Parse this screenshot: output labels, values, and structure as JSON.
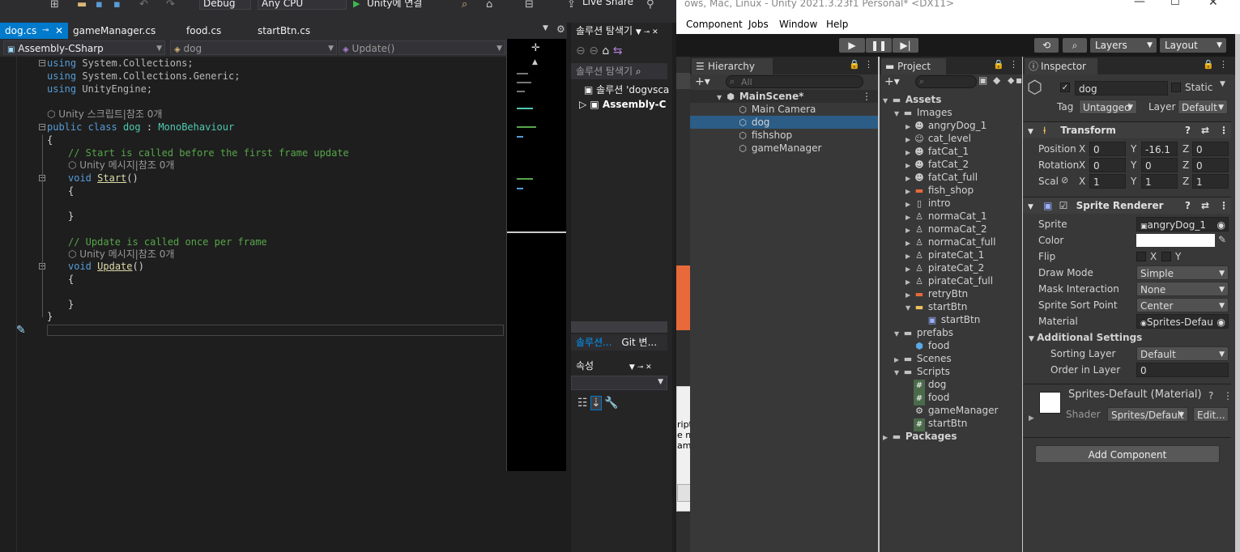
{
  "vs": {
    "toolbar": {
      "config": "Debug",
      "platform": "Any CPU",
      "run_label": "Unity에 연결",
      "live_share": "Live Share"
    },
    "tabs": [
      {
        "label": "dog.cs"
      },
      {
        "label": "gameManager.cs"
      },
      {
        "label": "food.cs"
      },
      {
        "label": "startBtn.cs"
      }
    ],
    "nav": {
      "project": "Assembly-CSharp",
      "class": "dog",
      "member": "Update()"
    },
    "code": {
      "using1_kw": "using",
      "using1": " System.Collections;",
      "using2_kw": "using",
      "using2": " System.Collections.Generic;",
      "using3_kw": "using",
      "using3": " UnityEngine;",
      "hint_class": "Unity 스크립트|참조 0개",
      "class_kw": "public class",
      "class_name": "dog",
      "class_sep": " : ",
      "class_base": "MonoBehaviour",
      "brace_open": "{",
      "comment_start": "// Start is called before the first frame update",
      "hint_start": "Unity 메시지|참조 0개",
      "start_kw": "void",
      "start_name": "Start",
      "start_paren": "()",
      "comment_update": "// Update is called once per frame",
      "hint_update": "Unity 메시지|참조 0개",
      "update_kw": "void",
      "update_name": "Update",
      "update_paren": "()",
      "brace_close": "}"
    },
    "solution": {
      "title": "솔루션 탐색기",
      "search": "솔루션 탐색기",
      "item1": "솔루션 'dogvsca",
      "item2": "Assembly-C",
      "tab1": "솔루션...",
      "tab2": "Git 변...",
      "props_title": "속성"
    }
  },
  "unity": {
    "title": "ows, Mac, Linux - Unity 2021.3.23f1 Personal* <DX11>",
    "menu": [
      "Component",
      "Jobs",
      "Window",
      "Help"
    ],
    "toolbar": {
      "layers": "Layers",
      "layout": "Layout"
    },
    "dialog_text": [
      "ript",
      "e no",
      "ame"
    ],
    "hierarchy": {
      "tab": "Hierarchy",
      "search_placeholder": "All",
      "scene": "MainScene*",
      "items": [
        "Main Camera",
        "dog",
        "fishshop",
        "gameManager"
      ]
    },
    "project": {
      "tab": "Project",
      "assets": "Assets",
      "images": "Images",
      "image_items": [
        "angryDog_1",
        "cat_level",
        "fatCat_1",
        "fatCat_2",
        "fatCat_full",
        "fish_shop",
        "intro",
        "normaCat_1",
        "normaCat_2",
        "normaCat_full",
        "pirateCat_1",
        "pirateCat_2",
        "pirateCat_full",
        "retryBtn",
        "startBtn"
      ],
      "startbtn_child": "startBtn",
      "prefabs": "prefabs",
      "prefab_items": [
        "food"
      ],
      "scenes": "Scenes",
      "scripts": "Scripts",
      "script_items": [
        "dog",
        "food",
        "gameManager",
        "startBtn"
      ],
      "packages": "Packages"
    },
    "inspector": {
      "tab": "Inspector",
      "name": "dog",
      "static_label": "Static",
      "tag_label": "Tag",
      "tag_value": "Untagged",
      "layer_label": "Layer",
      "layer_value": "Default",
      "transform": {
        "title": "Transform",
        "position_label": "Position",
        "position": {
          "x": "0",
          "y": "-16.1",
          "z": "0"
        },
        "rotation_label": "Rotation",
        "rotation": {
          "x": "0",
          "y": "0",
          "z": "0"
        },
        "scale_label": "Scal",
        "scale": {
          "x": "1",
          "y": "1",
          "z": "1"
        },
        "x": "X",
        "y": "Y",
        "z": "Z"
      },
      "sprite_renderer": {
        "title": "Sprite Renderer",
        "sprite_label": "Sprite",
        "sprite_value": "angryDog_1",
        "color_label": "Color",
        "color_value": "#ffffff",
        "flip_label": "Flip",
        "flip_x": "X",
        "flip_y": "Y",
        "draw_mode_label": "Draw Mode",
        "draw_mode": "Simple",
        "mask_label": "Mask Interaction",
        "mask": "None",
        "sort_point_label": "Sprite Sort Point",
        "sort_point": "Center",
        "material_label": "Material",
        "material": "Sprites-Defau",
        "additional": "Additional Settings",
        "sorting_layer_label": "Sorting Layer",
        "sorting_layer": "Default",
        "order_label": "Order in Layer",
        "order": "0"
      },
      "material_block": {
        "title": "Sprites-Default (Material)",
        "shader_label": "Shader",
        "shader": "Sprites/Default",
        "edit": "Edit..."
      },
      "add_component": "Add Component"
    }
  }
}
